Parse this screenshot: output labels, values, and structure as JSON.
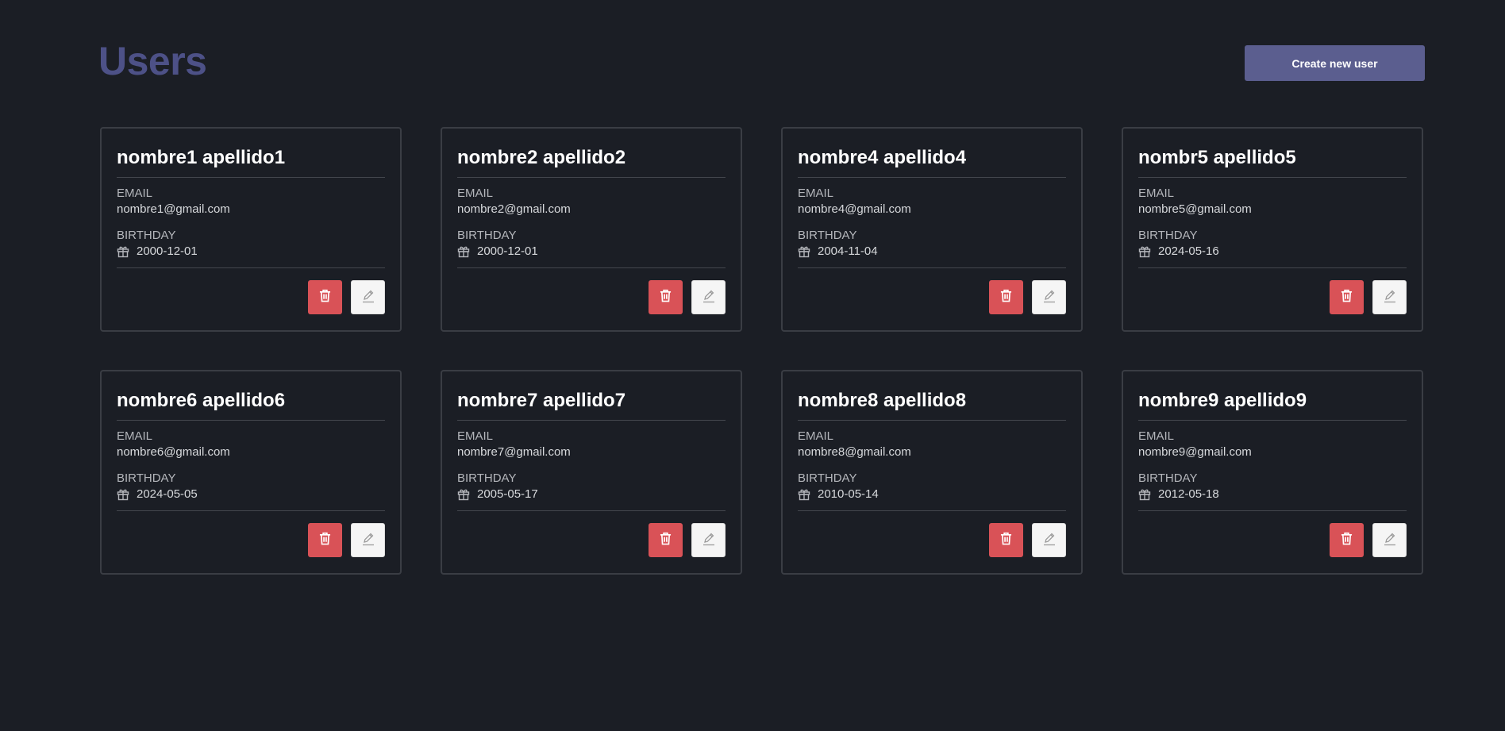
{
  "header": {
    "title": "Users",
    "create_label": "Create new user"
  },
  "labels": {
    "email": "EMAIL",
    "birthday": "BIRTHDAY"
  },
  "colors": {
    "delete": "#d95257",
    "accent": "#5b5e8f",
    "title": "#4d5187"
  },
  "icons": {
    "birthday": "gift-icon",
    "delete": "trash-icon",
    "edit": "pencil-icon"
  },
  "users": [
    {
      "name": "nombre1 apellido1",
      "email": "nombre1@gmail.com",
      "birthday": "2000-12-01"
    },
    {
      "name": "nombre2 apellido2",
      "email": "nombre2@gmail.com",
      "birthday": "2000-12-01"
    },
    {
      "name": "nombre4 apellido4",
      "email": "nombre4@gmail.com",
      "birthday": "2004-11-04"
    },
    {
      "name": "nombr5 apellido5",
      "email": "nombre5@gmail.com",
      "birthday": "2024-05-16"
    },
    {
      "name": "nombre6 apellido6",
      "email": "nombre6@gmail.com",
      "birthday": "2024-05-05"
    },
    {
      "name": "nombre7 apellido7",
      "email": "nombre7@gmail.com",
      "birthday": "2005-05-17"
    },
    {
      "name": "nombre8 apellido8",
      "email": "nombre8@gmail.com",
      "birthday": "2010-05-14"
    },
    {
      "name": "nombre9 apellido9",
      "email": "nombre9@gmail.com",
      "birthday": "2012-05-18"
    }
  ]
}
